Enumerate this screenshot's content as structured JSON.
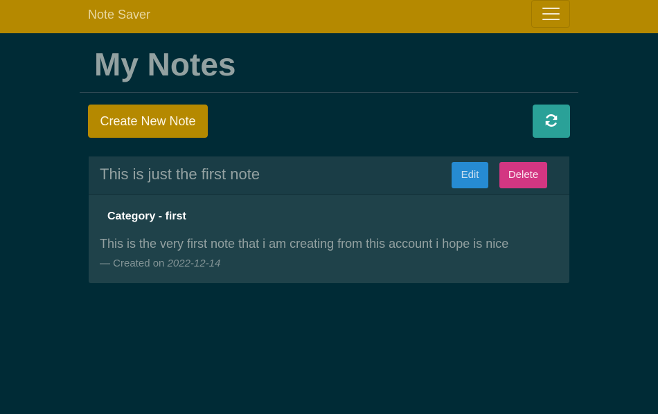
{
  "navbar": {
    "brand": "Note Saver",
    "toggle_icon": "hamburger-menu-icon"
  },
  "page": {
    "title": "My Notes"
  },
  "toolbar": {
    "create_label": "Create New Note",
    "refresh_icon": "refresh-icon"
  },
  "notes": [
    {
      "title": "This is just the first note",
      "edit_label": "Edit",
      "delete_label": "Delete",
      "category": "Category - first",
      "body": "This is the very first note that i am creating from this account i hope is nice",
      "created_prefix": "— Created on",
      "created_date": "2022-12-14"
    }
  ],
  "colors": {
    "background": "#002b36",
    "navbar": "#b58900",
    "create_button": "#b58900",
    "refresh_button": "#2aa198",
    "edit_button": "#268bd2",
    "delete_button": "#d33682",
    "card": "#1f424a"
  }
}
